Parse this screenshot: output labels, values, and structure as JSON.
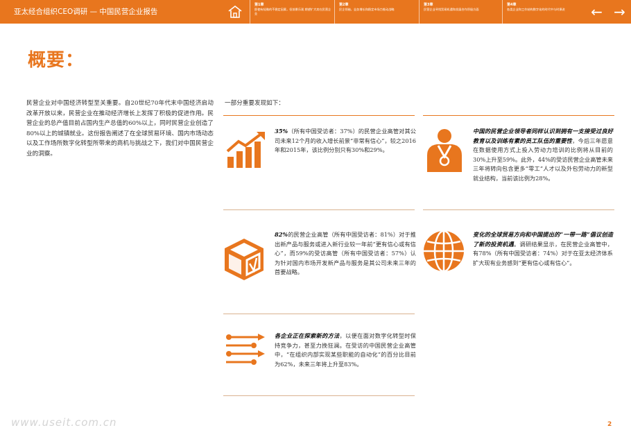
{
  "header": {
    "title": "亚太经合组织CEO调研 — 中国民营企业报告",
    "chapters": [
      {
        "num": "第1章",
        "desc": "即使有轻微的不稳定因素，但前景乐观 期望扩大其在民营企业"
      },
      {
        "num": "第2章",
        "desc": "民企领袖，业务增长和稳定市场力推动战略"
      },
      {
        "num": "第3章",
        "desc": "民营企业寻找贸易机遇和发展合作积极方面"
      },
      {
        "num": "第4章",
        "desc": "各类企业和工作结构数字化的时代中与时俱进"
      }
    ],
    "prev_icon": "←",
    "next_icon": "→"
  },
  "title": "概要：",
  "intro": "民营企业对中国经济转型至关重要。自20世纪70年代末中国经济启动改革开放以来，民营企业在推动经济增长上发挥了积极的促进作用。民营企业的总产值目前占国内生产总值的60%以上，同时民营企业创造了80%以上的城镇就业。这份报告阐述了在全球贸易环境、国内市场动态以及工作场所数字化转型所带来的商机与挑战之下，我们对中国民营企业的洞察。",
  "findings_label": "一部分重要发现如下：",
  "findings": [
    {
      "highlight": "35%",
      "text": "（所有中国受访者：37%）的民营企业高管对其公司未来12个月的收入增长前景“非常有信心”，较之2016年和2015年，该比例分别只有30%和29%。"
    },
    {
      "highlight": "中国的民营企业领导者同样认识到拥有一支接受过良好教育以及训练有素的员工队伍的重要性",
      "text": "，今后三年愿意在数据使用方式上投入劳动力培训的比例将从目前的30%上升至59%。此外，44%的受访民营企业高管未来三年将转向包含更多“零工”人才以及外包劳动力的新型就业结构，当前该比例为28%。"
    },
    {
      "highlight": "82%",
      "text": "的民营企业高管（所有中国受访者：81%）对于推出新产品与服务或进入新行业较一年前“更有信心或有信心”，而59%的受访高管（所有中国受访者：57%）认为针对国内市场开发新产品与服务是其公司未来三年的首要战略。"
    },
    {
      "highlight": "变化的全球贸易方向和中国提出的“一带一路”倡议创造了新的投资机遇",
      "text": "。调研结果显示，在民营企业高管中，有78%（所有中国受访者：74%）对于在亚太经济体系扩大现有业务感到“更有信心或有信心”。"
    },
    {
      "highlight": "各企业正在探索新的方法",
      "text": "，以便在面对数字化转型时保持竞争力，甚至力挽狂澜。在受访的中国民营企业高管中，“在组织内部实现某些职能的自动化”的百分比目前为62%，未来三年将上升至83%。"
    }
  ],
  "footer": {
    "watermark": "www.useit.com.cn",
    "page_number": "2"
  },
  "colors": {
    "accent": "#e8761e",
    "text": "#333333"
  },
  "icons": [
    "home-icon",
    "growth-chart-icon",
    "medal-person-icon",
    "cube-icon",
    "globe-icon",
    "circuit-arrows-icon"
  ]
}
